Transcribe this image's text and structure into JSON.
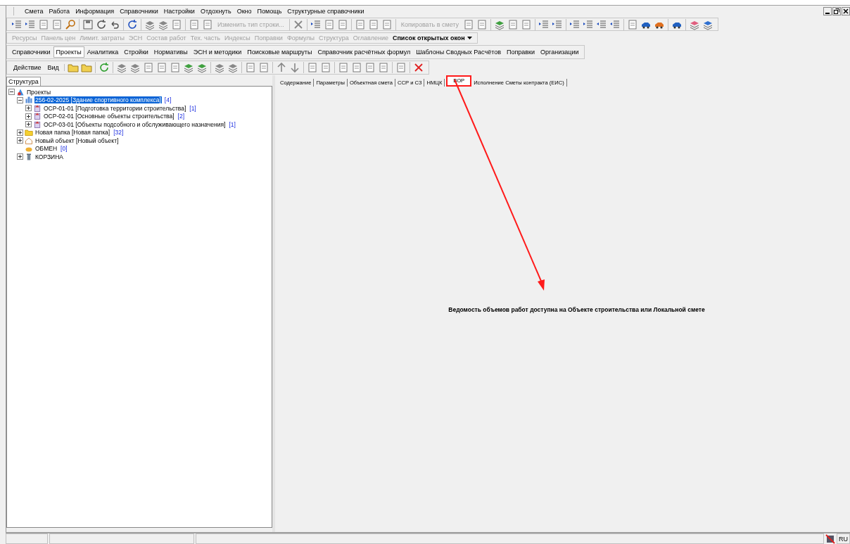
{
  "menu": [
    "Смета",
    "Работа",
    "Информация",
    "Справочники",
    "Настройки",
    "Отдохнуть",
    "Окно",
    "Помощь",
    "Структурные справочники"
  ],
  "main_toolbar": {
    "text_buttons": [
      {
        "label": "Изменить тип строки...",
        "disabled": true
      },
      {
        "label": "Копировать в смету",
        "disabled": true
      }
    ]
  },
  "windows_bar": [
    {
      "label": "Ресурсы",
      "kind": "item",
      "disabled": true
    },
    {
      "label": "Панель цен",
      "kind": "item",
      "disabled": true
    },
    {
      "label": "Лимит. затраты",
      "kind": "item",
      "disabled": true
    },
    {
      "label": "ЭСН",
      "kind": "item",
      "disabled": true
    },
    {
      "label": "Состав работ",
      "kind": "item",
      "disabled": true
    },
    {
      "label": "Тех. часть",
      "kind": "item",
      "disabled": true
    },
    {
      "label": "Индексы",
      "kind": "item",
      "disabled": true
    },
    {
      "label": "Поправки",
      "kind": "item",
      "disabled": true
    },
    {
      "label": "Формулы",
      "kind": "item",
      "disabled": true
    },
    {
      "label": "Структура",
      "kind": "item",
      "disabled": true
    },
    {
      "label": "Оглавление",
      "kind": "item",
      "disabled": true
    },
    {
      "label": "Список открытых окон",
      "kind": "dropdown",
      "disabled": false
    }
  ],
  "nav_tabs": [
    {
      "label": "Справочники",
      "selected": false
    },
    {
      "label": "Проекты",
      "selected": true
    },
    {
      "label": "Аналитика",
      "selected": false
    },
    {
      "label": "Стройки",
      "selected": false
    },
    {
      "label": "Нормативы",
      "selected": false
    },
    {
      "label": "ЭСН и методики",
      "selected": false
    },
    {
      "label": "Поисковые маршруты",
      "selected": false
    },
    {
      "label": "Справочник расчётных формул",
      "selected": false
    },
    {
      "label": "Шаблоны Сводных Расчётов",
      "selected": false
    },
    {
      "label": "Поправки",
      "selected": false
    },
    {
      "label": "Организации",
      "selected": false
    }
  ],
  "action_bar": [
    "Действие",
    "Вид"
  ],
  "left_panel": {
    "tab": "Структура",
    "tree": [
      {
        "kind": "projects",
        "label": "Проекты",
        "expanded": true,
        "selected": false,
        "children": [
          {
            "kind": "complex",
            "label": "256-02-2025 [Здание спортивного комплекса]",
            "count": "[4]",
            "expanded": true,
            "selected": true,
            "children": [
              {
                "kind": "estimate",
                "label": "ОСР-01-01  [Подготовка территории строительства]",
                "count": "[1]",
                "expanded": false,
                "selected": false
              },
              {
                "kind": "estimate",
                "label": "ОСР-02-01 [Основные объекты строительства]",
                "count": "[2]",
                "expanded": false,
                "selected": false
              },
              {
                "kind": "estimate",
                "label": "ОСР-03-01 [Объекты подсобного и обслуживающего назначения]",
                "count": "[1]",
                "expanded": false,
                "selected": false
              }
            ]
          },
          {
            "kind": "folder",
            "label": "Новая папка [Новая папка]",
            "count": "[32]",
            "expanded": false,
            "selected": false
          },
          {
            "kind": "object",
            "label": "Новый объект [Новый объект]",
            "expanded": false,
            "selected": false
          },
          {
            "kind": "exchange",
            "label": "ОБМЕН",
            "count": "[0]",
            "selected": false
          },
          {
            "kind": "trash",
            "label": "КОРЗИНА",
            "expanded": false,
            "selected": false
          }
        ]
      }
    ]
  },
  "right_panel": {
    "tabs": [
      {
        "label": "Содержание",
        "selected": false,
        "highlighted": false
      },
      {
        "label": "Параметры",
        "selected": false,
        "highlighted": false
      },
      {
        "label": "Объектная смета",
        "selected": false,
        "highlighted": false
      },
      {
        "label": "ССР и СЗ",
        "selected": false,
        "highlighted": false
      },
      {
        "label": "НМЦК",
        "selected": false,
        "highlighted": false
      },
      {
        "label": "ВОР",
        "selected": true,
        "highlighted": true
      },
      {
        "label": "Исполнение Сметы контракта (ЕИС)",
        "selected": false,
        "highlighted": false
      }
    ],
    "message": "Ведомость объемов работ доступна на Объекте строительства или Локальной смете"
  },
  "status_bar": {
    "language": "RU"
  }
}
